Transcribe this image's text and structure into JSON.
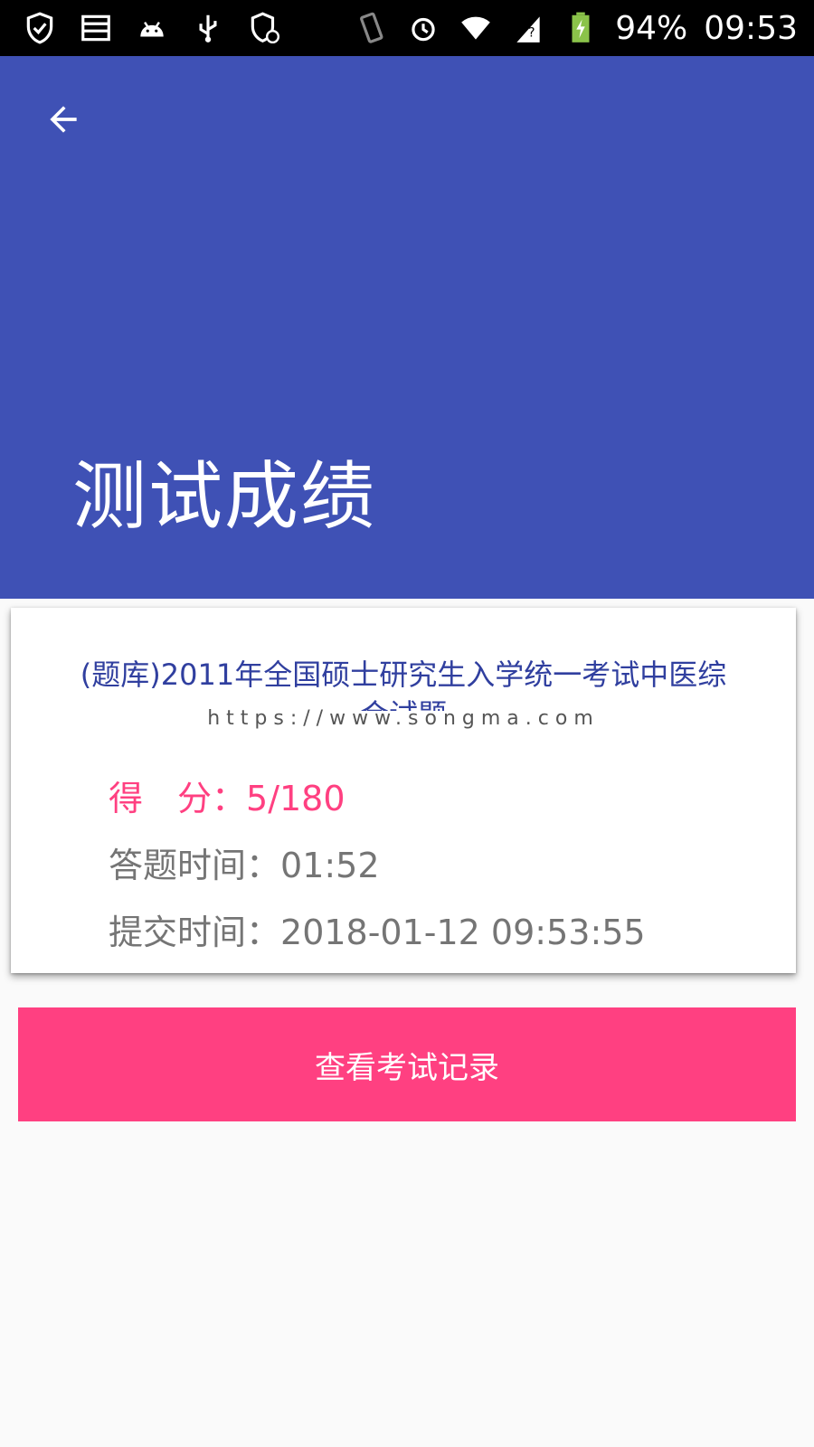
{
  "status_bar": {
    "left_icons": [
      "shield-check-icon",
      "storage-icon",
      "android-icon",
      "usb-icon",
      "shield-sync-icon"
    ],
    "right_icons": [
      "vibrate-icon",
      "alarm-icon",
      "wifi-icon",
      "sim-unknown-icon",
      "battery-charging-icon"
    ],
    "battery": "94%",
    "time": "09:53"
  },
  "header": {
    "title": "测试成绩",
    "background_color": "#3f51b5"
  },
  "result_card": {
    "exam_title": "(题库)2011年全国硕士研究生入学统一考试中医综",
    "exam_title_cont": "合试题",
    "watermark": "https://www.songma.com",
    "score_label": "得　分：",
    "score_value": "5/180",
    "answer_time_label": "答题时间：",
    "answer_time_value": "01:52",
    "submit_time_label": "提交时间：",
    "submit_time_value": "2018-01-12 09:53:55"
  },
  "actions": {
    "view_records_label": "查看考试记录",
    "accent_color": "#ff4081"
  }
}
